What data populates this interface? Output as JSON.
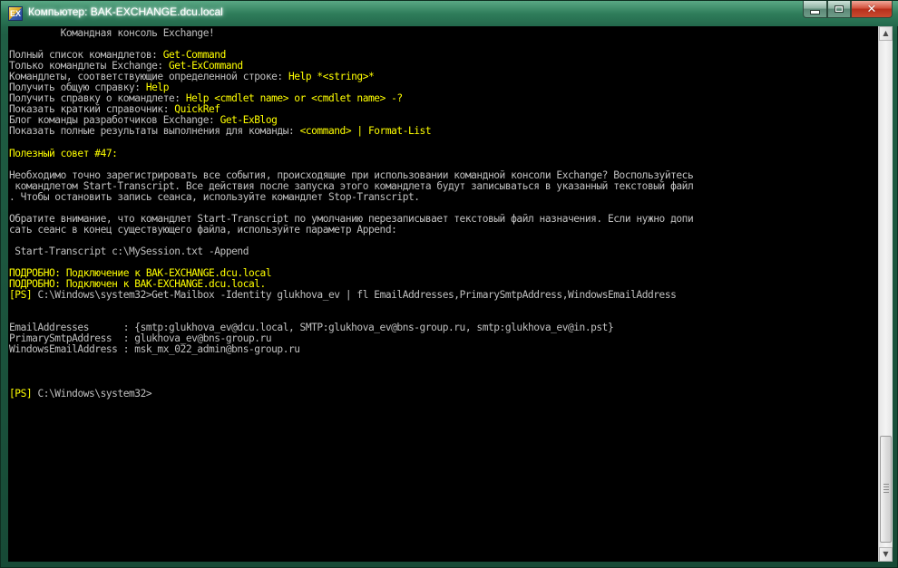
{
  "window": {
    "title": "Компьютер: BAK-EXCHANGE.dcu.local",
    "icon": "exchange-shell-icon",
    "icon_label": "EX",
    "controls": {
      "minimize_icon": "minimize-icon",
      "maximize_icon": "maximize-icon",
      "close_icon": "close-icon",
      "close_glyph": "✕"
    }
  },
  "scrollbar": {
    "up_arrow": "▲",
    "down_arrow": "▼"
  },
  "console": {
    "lines": [
      [
        {
          "c": "w",
          "t": "         Командная консоль Exchange!"
        }
      ],
      [
        {
          "c": "w",
          "t": ""
        }
      ],
      [
        {
          "c": "w",
          "t": "Полный список командлетов: "
        },
        {
          "c": "y",
          "t": "Get-Command"
        }
      ],
      [
        {
          "c": "w",
          "t": "Только командлеты Exchange: "
        },
        {
          "c": "y",
          "t": "Get-ExCommand"
        }
      ],
      [
        {
          "c": "w",
          "t": "Командлеты, соответствующие определенной строке: "
        },
        {
          "c": "y",
          "t": "Help *<string>*"
        }
      ],
      [
        {
          "c": "w",
          "t": "Получить общую справку: "
        },
        {
          "c": "y",
          "t": "Help"
        }
      ],
      [
        {
          "c": "w",
          "t": "Получить справку о командлете: "
        },
        {
          "c": "y",
          "t": "Help <cmdlet name> or <cmdlet name> -?"
        }
      ],
      [
        {
          "c": "w",
          "t": "Показать краткий справочник: "
        },
        {
          "c": "y",
          "t": "QuickRef"
        }
      ],
      [
        {
          "c": "w",
          "t": "Блог команды разработчиков Exchange: "
        },
        {
          "c": "y",
          "t": "Get-ExBlog"
        }
      ],
      [
        {
          "c": "w",
          "t": "Показать полные результаты выполнения для команды: "
        },
        {
          "c": "y",
          "t": "<command> | Format-List"
        }
      ],
      [
        {
          "c": "w",
          "t": ""
        }
      ],
      [
        {
          "c": "y",
          "t": "Полезный совет #47:"
        }
      ],
      [
        {
          "c": "w",
          "t": ""
        }
      ],
      [
        {
          "c": "w",
          "t": "Необходимо точно зарегистрировать все события, происходящие при использовании командной консоли Exchange? Воспользуйтесь"
        }
      ],
      [
        {
          "c": "w",
          "t": " командлетом Start-Transcript. Все действия после запуска этого командлета будут записываться в указанный текстовый файл"
        }
      ],
      [
        {
          "c": "w",
          "t": ". Чтобы остановить запись сеанса, используйте командлет Stop-Transcript."
        }
      ],
      [
        {
          "c": "w",
          "t": ""
        }
      ],
      [
        {
          "c": "w",
          "t": "Обратите внимание, что командлет Start-Transcript по умолчанию перезаписывает текстовый файл назначения. Если нужно допи"
        }
      ],
      [
        {
          "c": "w",
          "t": "сать сеанс в конец существующего файла, используйте параметр Append:"
        }
      ],
      [
        {
          "c": "w",
          "t": ""
        }
      ],
      [
        {
          "c": "w",
          "t": " Start-Transcript c:\\MySession.txt -Append"
        }
      ],
      [
        {
          "c": "w",
          "t": ""
        }
      ],
      [
        {
          "c": "y",
          "t": "ПОДРОБНО: Подключение к BAK-EXCHANGE.dcu.local"
        }
      ],
      [
        {
          "c": "y",
          "t": "ПОДРОБНО: Подключен к BAK-EXCHANGE.dcu.local."
        }
      ],
      [
        {
          "c": "y",
          "t": "[PS]"
        },
        {
          "c": "w",
          "t": " C:\\Windows\\system32>Get-Mailbox -Identity glukhova_ev | fl EmailAddresses,PrimarySmtpAddress,WindowsEmailAddress"
        }
      ],
      [
        {
          "c": "w",
          "t": ""
        }
      ],
      [
        {
          "c": "w",
          "t": ""
        }
      ],
      [
        {
          "c": "w",
          "t": "EmailAddresses      : {smtp:glukhova_ev@dcu.local, SMTP:glukhova_ev@bns-group.ru, smtp:glukhova_ev@in.pst}"
        }
      ],
      [
        {
          "c": "w",
          "t": "PrimarySmtpAddress  : glukhova_ev@bns-group.ru"
        }
      ],
      [
        {
          "c": "w",
          "t": "WindowsEmailAddress : msk_mx_022_admin@bns-group.ru"
        }
      ],
      [
        {
          "c": "w",
          "t": ""
        }
      ],
      [
        {
          "c": "w",
          "t": ""
        }
      ],
      [
        {
          "c": "w",
          "t": ""
        }
      ],
      [
        {
          "c": "y",
          "t": "[PS]"
        },
        {
          "c": "w",
          "t": " C:\\Windows\\system32>"
        }
      ]
    ]
  }
}
